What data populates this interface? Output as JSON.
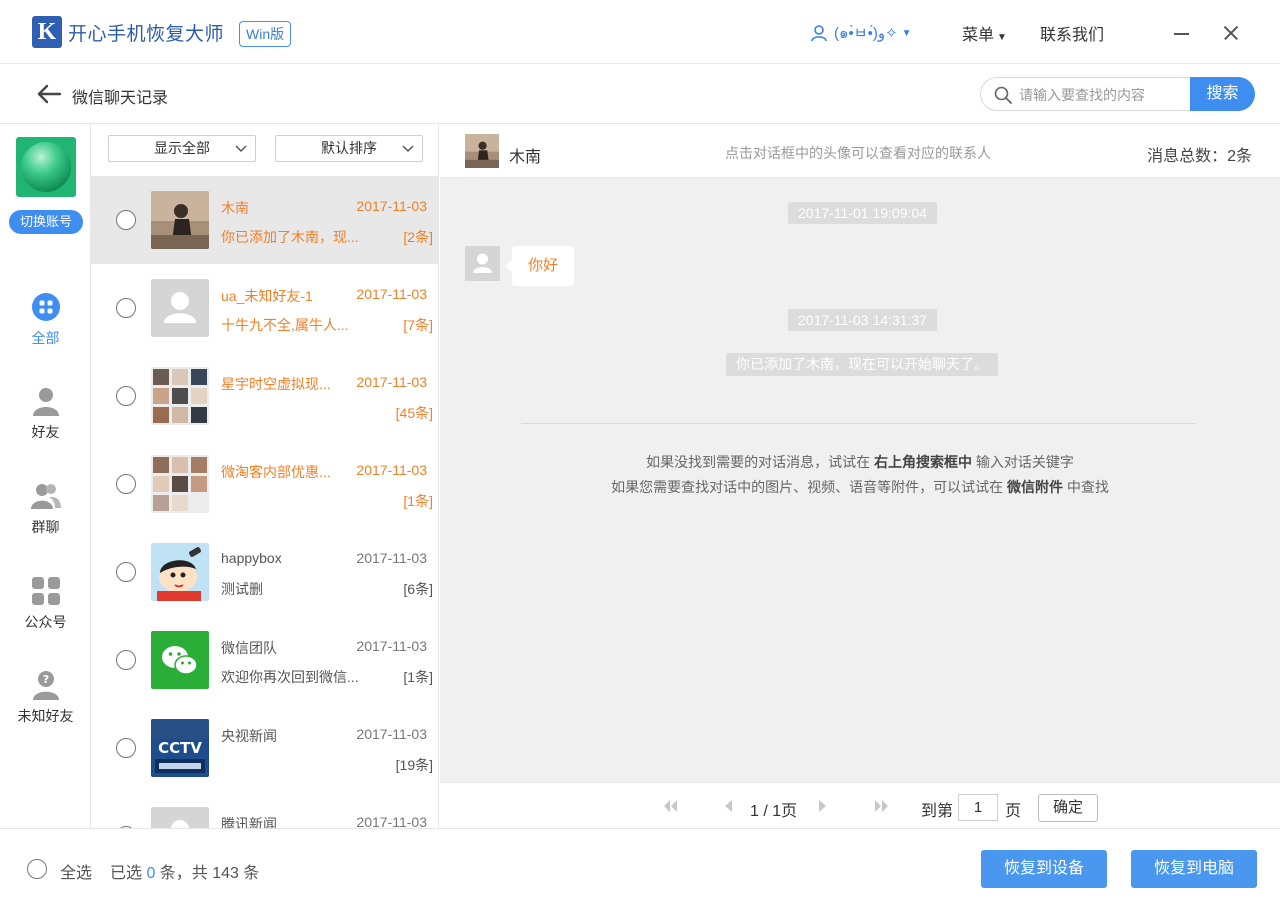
{
  "app": {
    "logo_letter": "K",
    "title": "开心手机恢复大师",
    "edition_badge": "Win版",
    "user_name": "(๑•̀ㅂ•́)و✧",
    "menu_label": "菜单",
    "contact_label": "联系我们"
  },
  "subheader": {
    "title": "微信聊天记录",
    "search_placeholder": "请输入要查找的内容",
    "search_button": "搜索"
  },
  "sidebar": {
    "switch_account": "切换账号",
    "items": [
      {
        "label": "全部",
        "icon": "grid-dots-icon",
        "active": true
      },
      {
        "label": "好友",
        "icon": "person-icon"
      },
      {
        "label": "群聊",
        "icon": "group-icon"
      },
      {
        "label": "公众号",
        "icon": "tiles-icon"
      },
      {
        "label": "未知好友",
        "icon": "unknown-person-icon"
      }
    ]
  },
  "filters": {
    "show": "显示全部",
    "sort": "默认排序"
  },
  "conversations": [
    {
      "name": "木南",
      "date": "2017-11-03",
      "preview": "你已添加了木南，现...",
      "count": "[2条]",
      "style": "orange",
      "selected": true
    },
    {
      "name": "ua_未知好友-1",
      "date": "2017-11-03",
      "preview": "十牛九不全,属牛人...",
      "count": "[7条]",
      "style": "orange"
    },
    {
      "name": "星宇时空虚拟现...",
      "date": "2017-11-03",
      "preview": "",
      "count": "[45条]",
      "style": "orange"
    },
    {
      "name": "微淘客内部优惠...",
      "date": "2017-11-03",
      "preview": "",
      "count": "[1条]",
      "style": "orange"
    },
    {
      "name": "happybox",
      "date": "2017-11-03",
      "preview": "测试删",
      "count": "[6条]",
      "style": "gray"
    },
    {
      "name": "微信团队",
      "date": "2017-11-03",
      "preview": "欢迎你再次回到微信...",
      "count": "[1条]",
      "style": "gray"
    },
    {
      "name": "央视新闻",
      "date": "2017-11-03",
      "preview": "",
      "count": "[19条]",
      "style": "gray"
    },
    {
      "name": "腾讯新闻",
      "date": "2017-11-03",
      "preview": "",
      "count": "",
      "style": "gray"
    }
  ],
  "chat": {
    "contact_name": "木南",
    "hint": "点击对话框中的头像可以查看对应的联系人",
    "total_label": "消息总数：2条",
    "time1": "2017-11-01 19:09:04",
    "message1": "你好",
    "time2": "2017-11-03 14:31:37",
    "system_message": "你已添加了木南，现在可以开始聊天了。",
    "tip1_a": "如果没找到需要的对话消息，试试在 ",
    "tip1_b": "右上角搜索框中",
    "tip1_c": " 输入对话关键字",
    "tip2_a": "如果您需要查找对话中的图片、视频、语音等附件，可以试试在 ",
    "tip2_b": "微信附件",
    "tip2_c": " 中查找"
  },
  "pager": {
    "page_info": "1 / 1页",
    "goto_label": "到第",
    "page_value": "1",
    "page_unit": "页",
    "confirm": "确定"
  },
  "footer": {
    "select_all": "全选",
    "selected_prefix": "已选 ",
    "selected_count": "0",
    "selected_suffix": " 条，共 143 条",
    "restore_device": "恢复到设备",
    "restore_pc": "恢复到电脑"
  },
  "colors": {
    "accent": "#3d8ef0",
    "brand": "#2b5cab",
    "highlight": "#f08028"
  }
}
